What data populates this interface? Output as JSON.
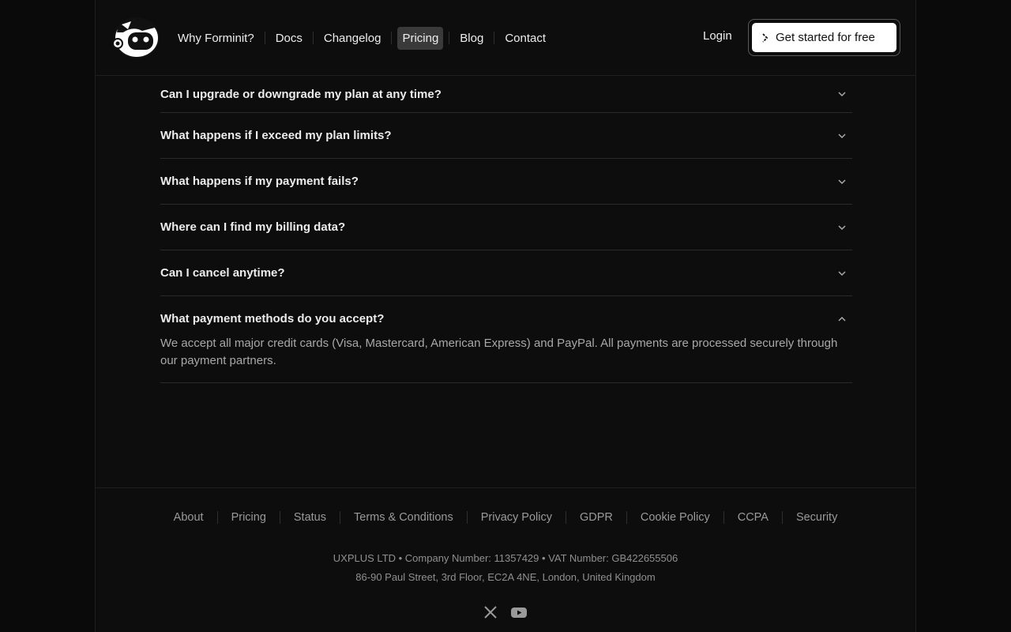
{
  "header": {
    "logo_icon": "robot-mascot-logo",
    "nav": [
      {
        "label": "Why Forminit?"
      },
      {
        "label": "Docs"
      },
      {
        "label": "Changelog"
      },
      {
        "label": "Pricing",
        "active": true
      },
      {
        "label": "Blog"
      },
      {
        "label": "Contact"
      }
    ],
    "login_label": "Login",
    "cta_label": "Get started for free",
    "cta_icon": "chevron-right-icon"
  },
  "faq": {
    "items": [
      {
        "question": "Can I upgrade or downgrade my plan at any time?",
        "expanded": false
      },
      {
        "question": "What happens if I exceed my plan limits?",
        "expanded": false
      },
      {
        "question": "What happens if my payment fails?",
        "expanded": false
      },
      {
        "question": "Where can I find my billing data?",
        "expanded": false
      },
      {
        "question": "Can I cancel anytime?",
        "expanded": false
      },
      {
        "question": "What payment methods do you accept?",
        "expanded": true,
        "answer": "We accept all major credit cards (Visa, Mastercard, American Express) and PayPal. All payments are processed securely through our payment partners."
      }
    ]
  },
  "footer": {
    "links": [
      "About",
      "Pricing",
      "Status",
      "Terms & Conditions",
      "Privacy Policy",
      "GDPR",
      "Cookie Policy",
      "CCPA",
      "Security"
    ],
    "company": "UXPLUS LTD • Company Number: 11357429 • VAT Number: GB422655506",
    "address": "86-90 Paul Street, 3rd Floor, EC2A 4NE, London, United Kingdom",
    "social": [
      "x-twitter-icon",
      "youtube-icon"
    ]
  },
  "colors": {
    "background": "#0d0d0d",
    "active_nav": "#3a3a3a",
    "cta_bg": "#ffffff"
  }
}
